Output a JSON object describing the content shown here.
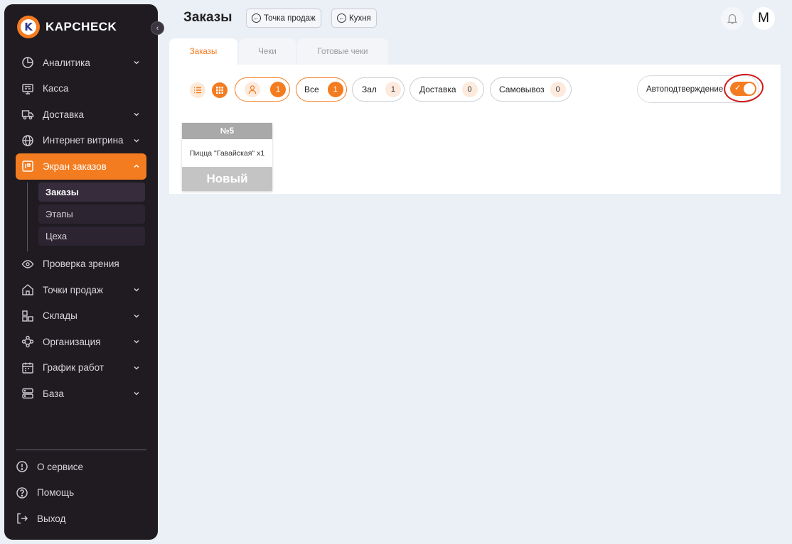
{
  "brand": {
    "name": "KAPCHECK",
    "mark": "K"
  },
  "sidebar": {
    "items": [
      {
        "label": "Аналитика",
        "icon": "analytics-icon",
        "has_chevron": true
      },
      {
        "label": "Касса",
        "icon": "cash-register-icon",
        "has_chevron": false
      },
      {
        "label": "Доставка",
        "icon": "truck-icon",
        "has_chevron": true
      },
      {
        "label": "Интернет витрина",
        "icon": "globe-icon",
        "has_chevron": true
      },
      {
        "label": "Экран заказов",
        "icon": "order-screen-icon",
        "has_chevron": true,
        "active": true,
        "sub": [
          {
            "label": "Заказы",
            "active": true
          },
          {
            "label": "Этапы"
          },
          {
            "label": "Цеха"
          }
        ]
      },
      {
        "label": "Проверка зрения",
        "icon": "eye-icon",
        "has_chevron": false
      },
      {
        "label": "Точки продаж",
        "icon": "home-icon",
        "has_chevron": true
      },
      {
        "label": "Склады",
        "icon": "warehouse-icon",
        "has_chevron": true
      },
      {
        "label": "Организация",
        "icon": "organization-icon",
        "has_chevron": true
      },
      {
        "label": "График работ",
        "icon": "calendar-icon",
        "has_chevron": true
      },
      {
        "label": "База",
        "icon": "database-icon",
        "has_chevron": true
      }
    ],
    "bottom": [
      {
        "label": "О сервисе",
        "icon": "info-icon"
      },
      {
        "label": "Помощь",
        "icon": "help-icon"
      },
      {
        "label": "Выход",
        "icon": "logout-icon"
      }
    ]
  },
  "header": {
    "title": "Заказы",
    "buttons": [
      {
        "label": "Точка продаж"
      },
      {
        "label": "Кухня"
      }
    ],
    "avatar_letter": "M"
  },
  "tabs": [
    {
      "label": "Заказы",
      "active": true
    },
    {
      "label": "Чеки"
    },
    {
      "label": "Готовые чеки"
    }
  ],
  "filters": {
    "person_count": "1",
    "chips": [
      {
        "label": "Все",
        "count": "1"
      },
      {
        "label": "Зал",
        "count": "1"
      },
      {
        "label": "Доставка",
        "count": "0"
      },
      {
        "label": "Самовывоз",
        "count": "0"
      }
    ]
  },
  "auto_confirm": {
    "label": "Автоподтверждение",
    "enabled": true
  },
  "orders": [
    {
      "number": "№5",
      "item": "Пицца \"Гавайская\" x1",
      "status": "Новый"
    }
  ],
  "colors": {
    "accent": "#f47c20",
    "sidebar_bg": "#1f1b21",
    "annotation": "#d01818"
  }
}
